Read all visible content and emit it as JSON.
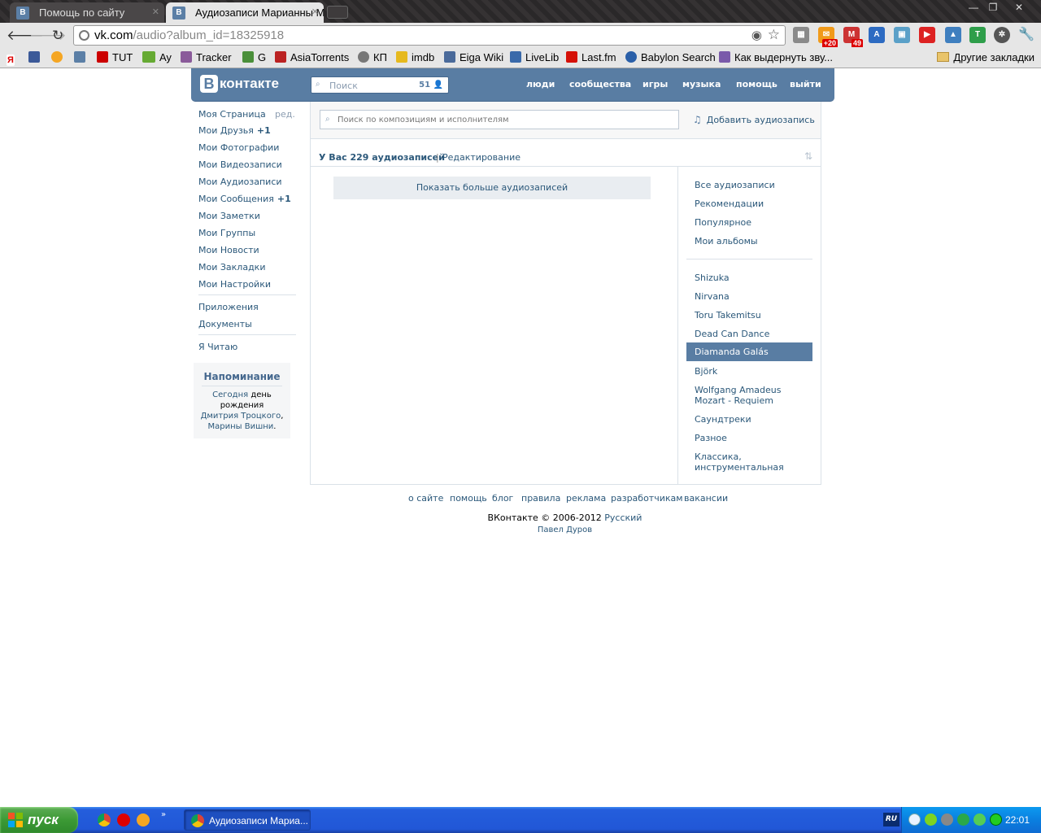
{
  "browser": {
    "tabs": [
      {
        "label": "Помощь по сайту",
        "favicon": "В"
      },
      {
        "label": "Аудиозаписи Марианны М",
        "favicon": "В"
      }
    ],
    "url_host": "vk.com",
    "url_path": "/audio?album_id=18325918",
    "extension_badges": {
      "mail": "+20",
      "gmail": "49"
    },
    "bookmarks": [
      {
        "label": "",
        "icon": "yandex-icon"
      },
      {
        "label": "",
        "icon": "facebook-icon"
      },
      {
        "label": "",
        "icon": "mail-ru-icon"
      },
      {
        "label": "",
        "icon": "vk-icon"
      },
      {
        "label": "TUT",
        "icon": "tut-icon"
      },
      {
        "label": "Ay",
        "icon": "ay-icon"
      },
      {
        "label": "Tracker",
        "icon": "tracker-icon"
      },
      {
        "label": "G",
        "icon": "google-icon"
      },
      {
        "label": "AsiaTorrents",
        "icon": "asiatorrents-icon"
      },
      {
        "label": "КП",
        "icon": "film-reel-icon"
      },
      {
        "label": "imdb",
        "icon": "imdb-icon"
      },
      {
        "label": "Eiga Wiki",
        "icon": "clapper-icon"
      },
      {
        "label": "LiveLib",
        "icon": "livelib-icon"
      },
      {
        "label": "Last.fm",
        "icon": "lastfm-icon"
      },
      {
        "label": "Babylon Search",
        "icon": "babylon-icon"
      },
      {
        "label": "Как выдернуть зву...",
        "icon": "puzzle-icon"
      }
    ],
    "other_bookmarks": "Другие закладки"
  },
  "vk": {
    "logo_letter": "В",
    "logo_text": "контакте",
    "search_placeholder": "Поиск",
    "search_count": "51",
    "nav": [
      "люди",
      "сообщества",
      "игры",
      "музыка",
      "помощь",
      "выйти"
    ],
    "left_menu": [
      {
        "label": "Моя Страница",
        "extra": ""
      },
      {
        "label": "Мои Друзья",
        "extra": "+1"
      },
      {
        "label": "Мои Фотографии",
        "extra": ""
      },
      {
        "label": "Мои Видеозаписи",
        "extra": ""
      },
      {
        "label": "Мои Аудиозаписи",
        "extra": ""
      },
      {
        "label": "Мои Сообщения",
        "extra": "+1"
      },
      {
        "label": "Мои Заметки",
        "extra": ""
      },
      {
        "label": "Мои Группы",
        "extra": ""
      },
      {
        "label": "Мои Новости",
        "extra": ""
      },
      {
        "label": "Мои Закладки",
        "extra": ""
      },
      {
        "label": "Мои Настройки",
        "extra": ""
      }
    ],
    "left_menu_edit": "ред.",
    "left_menu_2": [
      "Приложения",
      "Документы"
    ],
    "left_menu_3": [
      "Я Читаю"
    ],
    "reminder": {
      "title": "Напоминание",
      "t1": "Сегодня",
      "t2": "день рождения",
      "link1": "Дмитрия Троцкого",
      "t3": ",",
      "link2": "Марины Вишни",
      "t4": "."
    },
    "audio": {
      "search_placeholder": "Поиск по композициям и исполнителям",
      "add_label": "Добавить аудиозапись",
      "count_label": "У Вас 229 аудиозаписей",
      "edit_label": "Редактирование",
      "more_label": "Показать больше аудиозаписей",
      "sections": [
        "Все аудиозаписи",
        "Рекомендации",
        "Популярное",
        "Мои альбомы"
      ],
      "albums": [
        "Shizuka",
        "Nirvana",
        "Toru Takemitsu",
        "Dead Can Dance",
        "Diamanda Galás",
        "Björk",
        "Wolfgang Amadeus Mozart - Requiem",
        "Саундтреки",
        "Разное",
        "Классика, инструментальная"
      ],
      "selected_album": "Diamanda Galás"
    },
    "footer_links": [
      "о сайте",
      "помощь",
      "блог",
      "правила",
      "реклама",
      "разработчикам",
      "вакансии"
    ],
    "copyright": "ВКонтакте © 2006-2012",
    "language": "Русский",
    "author": "Павел Дуров"
  },
  "taskbar": {
    "start_label": "пуск",
    "task_label": "Аудиозаписи Мариа...",
    "lang": "RU",
    "clock": "22:01"
  },
  "colors": {
    "vk_blue": "#597da3",
    "link": "#2b587a",
    "xp_start": "#3c9a35",
    "xp_bar": "#245edc"
  }
}
